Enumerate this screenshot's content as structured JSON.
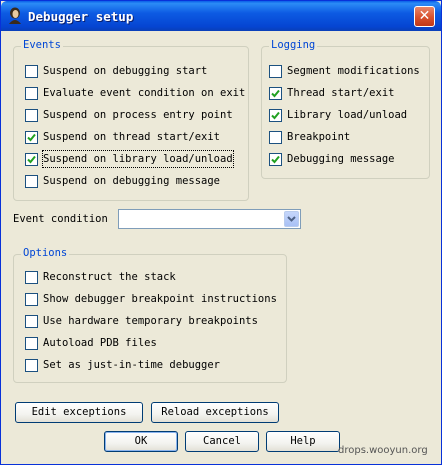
{
  "window": {
    "title": "Debugger setup",
    "close_symbol": "✕"
  },
  "events": {
    "label": "Events",
    "items": [
      {
        "label": "Suspend on debugging start",
        "checked": false
      },
      {
        "label": "Evaluate event condition on exit",
        "checked": false
      },
      {
        "label": "Suspend on process entry point",
        "checked": false
      },
      {
        "label": "Suspend on thread start/exit",
        "checked": true
      },
      {
        "label": "Suspend on library load/unload",
        "checked": true
      },
      {
        "label": "Suspend on debugging message",
        "checked": false
      }
    ]
  },
  "logging": {
    "label": "Logging",
    "items": [
      {
        "label": "Segment modifications",
        "checked": false
      },
      {
        "label": "Thread start/exit",
        "checked": true
      },
      {
        "label": "Library load/unload",
        "checked": true
      },
      {
        "label": "Breakpoint",
        "checked": false
      },
      {
        "label": "Debugging message",
        "checked": true
      }
    ]
  },
  "event_condition": {
    "label": "Event condition",
    "value": ""
  },
  "options": {
    "label": "Options",
    "items": [
      {
        "label": "Reconstruct the stack",
        "checked": false
      },
      {
        "label": "Show debugger breakpoint instructions",
        "checked": false
      },
      {
        "label": "Use hardware temporary breakpoints",
        "checked": false
      },
      {
        "label": "Autoload PDB files",
        "checked": false
      },
      {
        "label": "Set as just-in-time debugger",
        "checked": false
      }
    ]
  },
  "buttons": {
    "edit_exceptions": "Edit exceptions",
    "reload_exceptions": "Reload exceptions",
    "ok": "OK",
    "cancel": "Cancel",
    "help": "Help"
  },
  "watermark": "drops.wooyun.org",
  "colors": {
    "titlebar": "#0545d2",
    "group_label": "#0046d5",
    "face": "#ece9d8",
    "check": "#21a121"
  }
}
